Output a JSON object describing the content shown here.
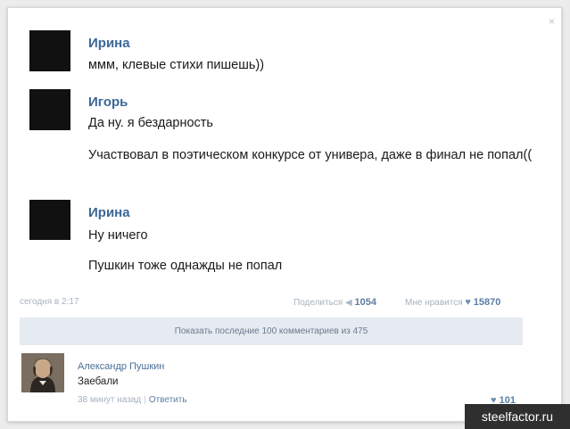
{
  "close_icon": "×",
  "messages": [
    {
      "author": "Ирина",
      "lines": [
        "ммм, клевые стихи пишешь))"
      ]
    },
    {
      "author": "Игорь",
      "lines": [
        "Да ну. я бездарность",
        "Участвовал в поэтическом конкурсе от универа, даже в финал не попал(("
      ]
    },
    {
      "author": "Ирина",
      "lines": [
        "Ну ничего",
        "Пушкин тоже однажды не попал"
      ]
    }
  ],
  "post_meta": {
    "date": "сегодня в 2:17",
    "share_label": "Поделиться",
    "share_count": "1054",
    "like_label": "Мне нравится",
    "like_count": "15870"
  },
  "show_all": "Показать последние 100 комментариев из 475",
  "comment": {
    "author": "Александр Пушкин",
    "text": "Заебали",
    "time": "38 минут назад",
    "reply": "Ответить",
    "likes": "101"
  },
  "watermark": "steelfactor.ru"
}
